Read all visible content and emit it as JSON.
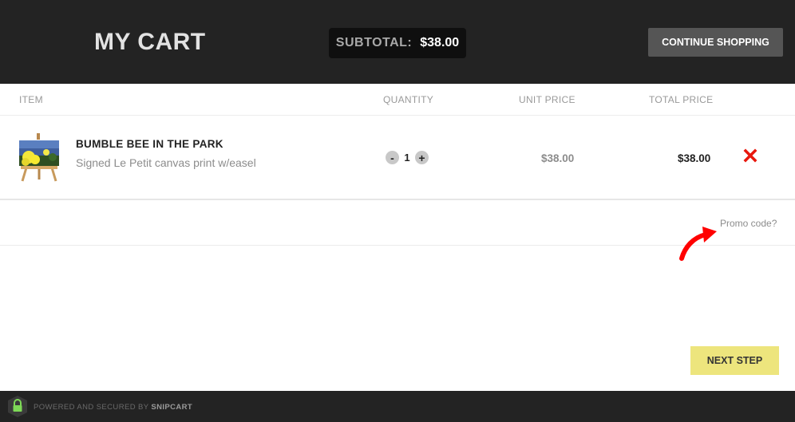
{
  "header": {
    "title": "MY CART",
    "subtotal_label": "SUBTOTAL:",
    "subtotal_value": "$38.00",
    "continue_label": "CONTINUE SHOPPING"
  },
  "columns": {
    "item": "ITEM",
    "quantity": "QUANTITY",
    "unit_price": "UNIT PRICE",
    "total_price": "TOTAL PRICE"
  },
  "cart_item": {
    "name": "BUMBLE BEE IN THE PARK",
    "description": "Signed Le Petit canvas print w/easel",
    "minus": "-",
    "plus": "+",
    "quantity": "1",
    "unit_price": "$38.00",
    "total_price": "$38.00"
  },
  "promo": {
    "label": "Promo code?"
  },
  "next_step_label": "NEXT STEP",
  "footer": {
    "powered_by": "POWERED AND SECURED BY",
    "brand": "SNIPCART"
  },
  "icons": {
    "remove": "close-icon",
    "arrow": "arrow-icon",
    "lock": "lock-icon"
  },
  "colors": {
    "header_bg": "#232323",
    "next_button": "#ede57d",
    "remove": "#e8170d",
    "arrow": "#ff0000",
    "lock_green": "#7ed957"
  }
}
